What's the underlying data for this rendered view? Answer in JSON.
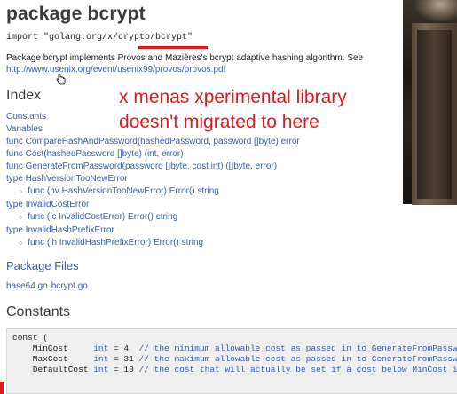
{
  "page": {
    "title": "package bcrypt",
    "import_line": "import \"golang.org/x/crypto/bcrypt\"",
    "description": "Package bcrypt implements Provos and Mazières's bcrypt adaptive hashing algorithm. See",
    "description_link": "http://www.usenix.org/event/usenix99/provos/provos.pdf"
  },
  "annotation": {
    "line1": "x  menas xperimental library",
    "line2": "doesn't migrated to here",
    "color": "#e8161b"
  },
  "index": {
    "title": "Index",
    "items": [
      {
        "text": "Constants",
        "sub": false
      },
      {
        "text": "Variables",
        "sub": false
      },
      {
        "text": "func CompareHashAndPassword(hashedPassword, password []byte) error",
        "sub": false
      },
      {
        "text": "func Cost(hashedPassword []byte) (int, error)",
        "sub": false
      },
      {
        "text": "func GenerateFromPassword(password []byte, cost int) ([]byte, error)",
        "sub": false
      },
      {
        "text": "type HashVersionTooNewError",
        "sub": false
      },
      {
        "text": "func (hv HashVersionTooNewError) Error() string",
        "sub": true
      },
      {
        "text": "type InvalidCostError",
        "sub": false
      },
      {
        "text": "func (ic InvalidCostError) Error() string",
        "sub": true
      },
      {
        "text": "type InvalidHashPrefixError",
        "sub": false
      },
      {
        "text": "func (ih InvalidHashPrefixError) Error() string",
        "sub": true
      }
    ]
  },
  "package_files": {
    "title": "Package Files",
    "files": [
      "base64.go",
      "bcrypt.go"
    ]
  },
  "constants": {
    "title": "Constants",
    "code_lines": [
      "const (",
      "    MinCost     int = 4  // the minimum allowable cost as passed in to GenerateFromPassw",
      "    MaxCost     int = 31 // the maximum allowable cost as passed in to GenerateFromPassw",
      "    DefaultCost int = 10 // the cost that will actually be set if a cost below MinCost i"
    ]
  },
  "colors": {
    "link": "#375eab",
    "heading": "#3b3b3b",
    "annotation_red": "#e8161b",
    "code_bg": "#efefef"
  },
  "icons": {
    "cursor": "hand-pointer-icon"
  }
}
